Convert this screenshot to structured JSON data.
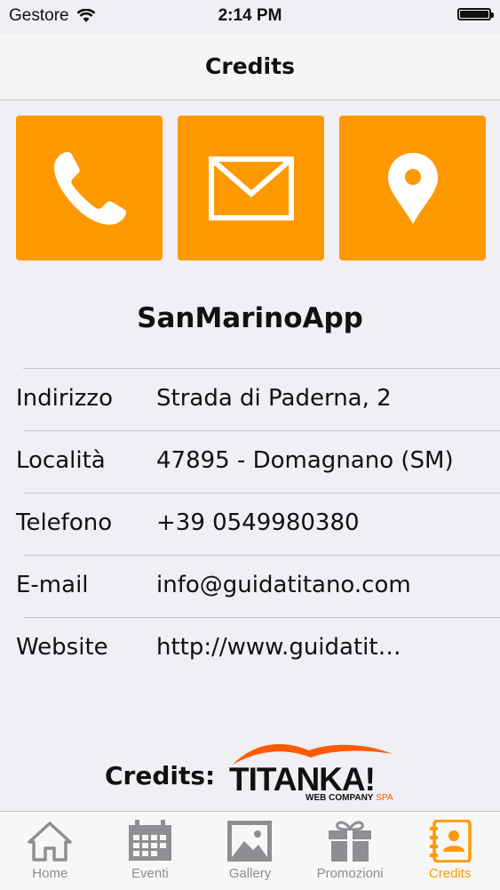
{
  "status": {
    "carrier": "Gestore",
    "time": "2:14 PM"
  },
  "nav": {
    "title": "Credits"
  },
  "actions": [
    {
      "icon": "phone-icon"
    },
    {
      "icon": "mail-icon"
    },
    {
      "icon": "map-pin-icon"
    }
  ],
  "org": {
    "name": "SanMarinoApp"
  },
  "info": [
    {
      "label": "Indirizzo",
      "value": "Strada di Paderna, 2"
    },
    {
      "label": "Località",
      "value": "47895 - Domagnano (SM)"
    },
    {
      "label": "Telefono",
      "value": "+39 0549980380"
    },
    {
      "label": "E-mail",
      "value": "info@guidatitano.com"
    },
    {
      "label": "Website",
      "value": "http://www.guidatit…"
    }
  ],
  "credits": {
    "label": "Credits:",
    "logo_text": "TITANKA!",
    "logo_sub": "WEB COMPANY",
    "logo_sub2": "SPA"
  },
  "tabs": [
    {
      "label": "Home",
      "icon": "home-icon"
    },
    {
      "label": "Eventi",
      "icon": "calendar-icon"
    },
    {
      "label": "Gallery",
      "icon": "image-icon"
    },
    {
      "label": "Promozioni",
      "icon": "gift-icon"
    },
    {
      "label": "Credits",
      "icon": "contacts-book-icon"
    }
  ],
  "active_tab": "Credits",
  "colors": {
    "accent": "#ff9900",
    "tab_inactive": "#8e8e93",
    "separator": "#c8c7cc"
  }
}
